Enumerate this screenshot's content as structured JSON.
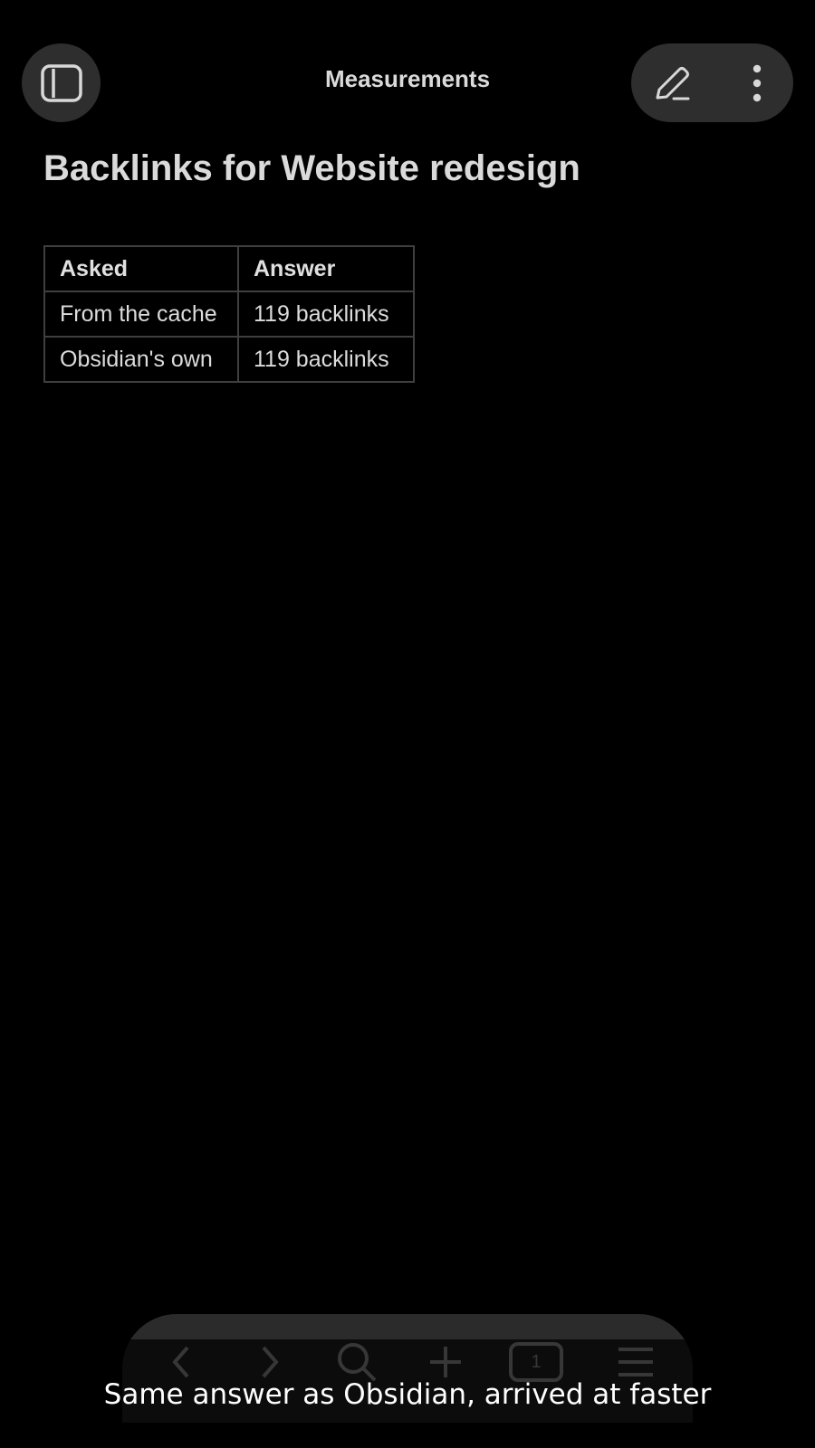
{
  "header": {
    "view_title": "Measurements",
    "sidebar_icon": "sidebar-toggle-icon",
    "edit_icon": "pencil-icon",
    "more_icon": "more-vertical-icon"
  },
  "note": {
    "title": "Backlinks for Website redesign",
    "table": {
      "headers": [
        "Asked",
        "Answer"
      ],
      "rows": [
        [
          "From the cache",
          "119 backlinks"
        ],
        [
          "Obsidian's own",
          "119 backlinks"
        ]
      ]
    }
  },
  "bottom_nav": {
    "items": [
      "back-icon",
      "forward-icon",
      "search-icon",
      "plus-icon",
      "tabs-icon",
      "menu-icon"
    ],
    "tab_count": "1"
  },
  "caption": "Same answer as Obsidian, arrived at faster"
}
